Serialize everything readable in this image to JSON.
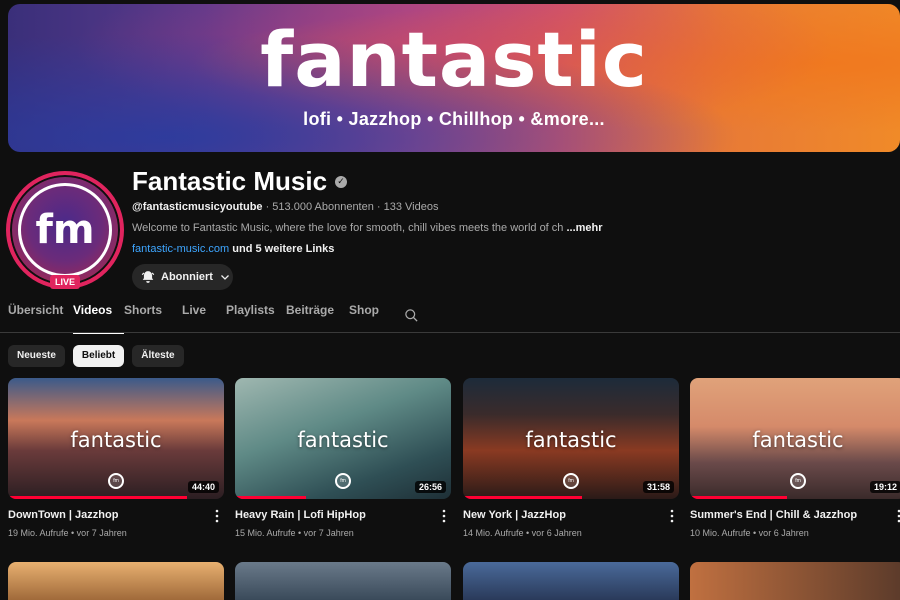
{
  "banner": {
    "title": "fantastic",
    "subtitle": "lofi • Jazzhop • Chillhop • &more..."
  },
  "avatar": {
    "text": "fm",
    "live_label": "LIVE"
  },
  "channel": {
    "name": "Fantastic Music",
    "handle": "@fantasticmusicyoutube",
    "stats": " · 513.000 Abonnenten · 133 Videos",
    "description": "Welcome to Fantastic Music, where the love for smooth, chill vibes meets the world of ch",
    "description_more": "...mehr",
    "link_url": "fantastic-music.com",
    "link_more": " und 5 weitere Links",
    "subscribe_label": "Abonniert"
  },
  "tabs": [
    {
      "label": "Übersicht"
    },
    {
      "label": "Videos"
    },
    {
      "label": "Shorts"
    },
    {
      "label": "Live"
    },
    {
      "label": "Playlists"
    },
    {
      "label": "Beiträge"
    },
    {
      "label": "Shop"
    }
  ],
  "chips": [
    {
      "label": "Neueste"
    },
    {
      "label": "Beliebt"
    },
    {
      "label": "Älteste"
    }
  ],
  "videos": [
    {
      "title": "DownTown | Jazzhop",
      "meta": "19 Mio. Aufrufe • vor 7 Jahren",
      "duration": "44:40",
      "overlay": "fantastic",
      "progress": 0.83
    },
    {
      "title": "Heavy Rain | Lofi HipHop",
      "meta": "15 Mio. Aufrufe • vor 7 Jahren",
      "duration": "26:56",
      "overlay": "fantastic",
      "progress": 0.33
    },
    {
      "title": "New York | JazzHop",
      "meta": "14 Mio. Aufrufe • vor 6 Jahren",
      "duration": "31:58",
      "overlay": "fantastic",
      "progress": 0.55
    },
    {
      "title": "Summer's End | Chill & Jazzhop",
      "meta": "10 Mio. Aufrufe • vor 6 Jahren",
      "duration": "19:12",
      "overlay": "fantastic",
      "progress": 0.45
    }
  ],
  "colors": {
    "accent": "#ff0033",
    "link": "#3ea6ff",
    "live": "#e0245e"
  }
}
